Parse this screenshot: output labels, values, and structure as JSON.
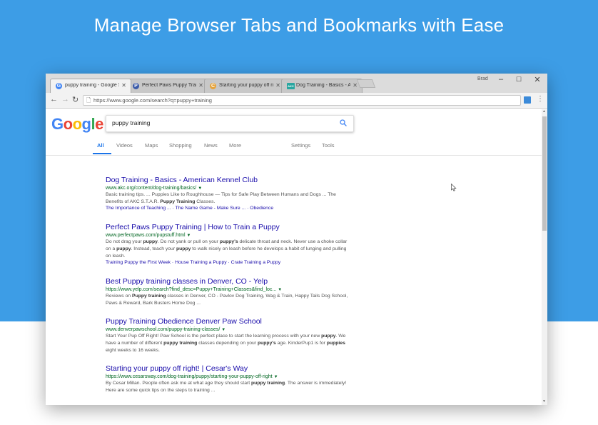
{
  "hero": {
    "title": "Manage Browser Tabs and Bookmarks with Ease"
  },
  "browser": {
    "tabs": [
      {
        "label": "puppy training - Google S",
        "favicon": "G",
        "favicon_color": "#4285f4",
        "active": true
      },
      {
        "label": "Perfect Paws Puppy Train",
        "favicon": "P",
        "favicon_color": "#3b5ba9",
        "active": false
      },
      {
        "label": "Starting your puppy off ri",
        "favicon": "C",
        "favicon_color": "#e6a33a",
        "active": false
      },
      {
        "label": "Dog Training - Basics - A",
        "favicon": "AKC",
        "favicon_color": "#2aa6a0",
        "active": false
      }
    ],
    "user_label": "Brad",
    "url": "https://www.google.com/search?q=puppy+training"
  },
  "google": {
    "logo_letters": [
      {
        "ch": "G",
        "color": "#4285f4"
      },
      {
        "ch": "o",
        "color": "#ea4335"
      },
      {
        "ch": "o",
        "color": "#fbbc05"
      },
      {
        "ch": "g",
        "color": "#4285f4"
      },
      {
        "ch": "l",
        "color": "#34a853"
      },
      {
        "ch": "e",
        "color": "#ea4335"
      }
    ],
    "query": "puppy training",
    "tabs": [
      "All",
      "Videos",
      "Maps",
      "Shopping",
      "News",
      "More",
      "Settings",
      "Tools"
    ]
  },
  "results": [
    {
      "title": "Dog Training - Basics - American Kennel Club",
      "url": "www.akc.org/content/dog-training/basics/",
      "snippet": "Basic training tips. ... Puppies Like to Roughhouse — Tips for Safe Play Between Humans and Dogs ... The Benefits of AKC S.T.A.R. <b>Puppy Training</b> Classes.",
      "links": "The Importance of Teaching ... · The Name Game - Make Sure ... · Obedience"
    },
    {
      "title": "Perfect Paws Puppy Training | How to Train a Puppy",
      "url": "www.perfectpaws.com/pupstuff.html",
      "snippet": "Do not drag your <b>puppy</b>. Do not yank or pull on your <b>puppy's</b> delicate throat and neck. Never use a choke collar on a <b>puppy</b>. Instead, teach your <b>puppy</b> to walk nicely on leash before he develops a habit of lunging and pulling on leash.",
      "links": "Training Puppy the First Week · House Training a Puppy · Crate Training a Puppy"
    },
    {
      "title": "Best Puppy training classes in Denver, CO - Yelp",
      "url": "https://www.yelp.com/search?find_desc=Puppy+Training+Classes&find_loc...",
      "snippet": "Reviews on <b>Puppy training</b> classes in Denver, CO - Pavlov Dog Training, Wag &amp; Train, Happy Tails Dog School, Paws &amp; Reward, Bark Busters Home Dog ...",
      "links": ""
    },
    {
      "title": "Puppy Training Obedience Denver Paw School",
      "url": "www.denverpawschool.com/puppy-training-classes/",
      "snippet": "Start Your Pup Off Right! Paw School is the perfect place to start the learning process with your new <b>puppy</b>. We have a number of different <b>puppy training</b> classes depending on your <b>puppy's</b> age. KinderPup1 is for <b>puppies</b> eight weeks to 16 weeks.",
      "links": ""
    },
    {
      "title": "Starting your puppy off right! | Cesar's Way",
      "url": "https://www.cesarsway.com/dog-training/puppy/starting-your-puppy-off-right",
      "snippet": "By Cesar Millan. People often ask me at what age they should start <b>puppy training</b>. The answer is immediately! Here are some quick tips on the steps to training ...",
      "links": ""
    }
  ]
}
